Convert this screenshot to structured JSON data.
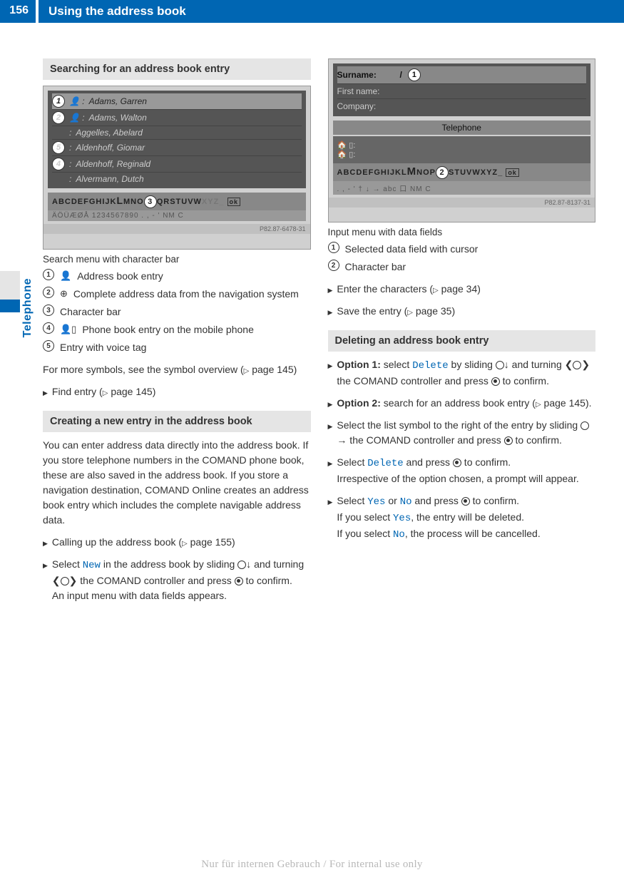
{
  "header": {
    "page_number": "156",
    "title": "Using the address book"
  },
  "side_tab": "Telephone",
  "left": {
    "section1_title": "Searching for an address book entry",
    "fig1": {
      "rows": [
        "Adams, Garren",
        "Adams, Walton",
        "Aggelles, Abelard",
        "Aldenhoff, Giomar",
        "Aldenhoff, Reginald",
        "Alvermann, Dutch"
      ],
      "charbar": "ABCDEFGHIJKLMNOPQRSTUVWXYZ_ ok",
      "charbar_sub": "ÄÖÜÆØÅ 1234567890 . , - ' NM C",
      "code": "P82.87-6478-31"
    },
    "fig1_caption": "Search menu with character bar",
    "legend1": {
      "i1": "Address book entry",
      "i2": "Complete address data from the navigation system",
      "i3": "Character bar",
      "i4": "Phone book entry on the mobile phone",
      "i5": "Entry with voice tag"
    },
    "symbols_note_a": "For more symbols, see the symbol overview (",
    "symbols_note_b": " page 145)",
    "find_entry_a": "Find entry (",
    "find_entry_b": " page 145)",
    "section2_title": "Creating a new entry in the address book",
    "create_intro": "You can enter address data directly into the address book. If you store telephone numbers in the COMAND phone book, these are also saved in the address book. If you store a navigation destination, COMAND Online creates an address book entry which includes the complete navigable address data.",
    "step_call_a": "Calling up the address book (",
    "step_call_b": " page 155)",
    "step_new_a": "Select ",
    "step_new_cmd": "New",
    "step_new_b": " in the address book by sliding ",
    "step_new_c": " and turning ",
    "step_new_d": " the COMAND controller and press ",
    "step_new_e": " to confirm.",
    "step_new_result": "An input menu with data fields appears."
  },
  "right": {
    "fig2": {
      "surname_label": "Surname:",
      "surname_val": "/",
      "first_label": "First name:",
      "company_label": "Company:",
      "telephone_label": "Telephone",
      "charbar": "ABCDEFGHIJKLMNOPQRSTUVWXYZ_ ok",
      "charbar_sub": ". , - ' † ↓ → abc 口 NM C",
      "code": "P82.87-8137-31"
    },
    "fig2_caption": "Input menu with data fields",
    "legend2": {
      "i1": "Selected data field with cursor",
      "i2": "Character bar"
    },
    "enter_chars_a": "Enter the characters (",
    "enter_chars_b": " page 34)",
    "save_entry_a": "Save the entry (",
    "save_entry_b": " page 35)",
    "section3_title": "Deleting an address book entry",
    "opt1_label": "Option 1:",
    "opt1_a": " select ",
    "opt1_cmd": "Delete",
    "opt1_b": " by sliding ",
    "opt1_c": " and turning ",
    "opt1_d": " the COMAND controller and press ",
    "opt1_e": " to confirm.",
    "opt2_label": "Option 2:",
    "opt2_a": " search for an address book entry (",
    "opt2_b": " page 145).",
    "step_list_a": "Select the list symbol to the right of the entry by sliding ",
    "step_list_b": " the COMAND controller and press ",
    "step_list_c": " to confirm.",
    "step_del_a": "Select ",
    "step_del_cmd": "Delete",
    "step_del_b": " and press ",
    "step_del_c": " to confirm.",
    "step_prompt": "Irrespective of the option chosen, a prompt will appear.",
    "step_yn_a": "Select ",
    "step_yn_yes": "Yes",
    "step_yn_or": " or ",
    "step_yn_no": "No",
    "step_yn_b": " and press ",
    "step_yn_c": " to confirm.",
    "step_yes_a": "If you select ",
    "step_yes_b": ", the entry will be deleted.",
    "step_no_a": "If you select ",
    "step_no_b": ", the process will be cancelled."
  },
  "footer": "Nur für internen Gebrauch / For internal use only"
}
